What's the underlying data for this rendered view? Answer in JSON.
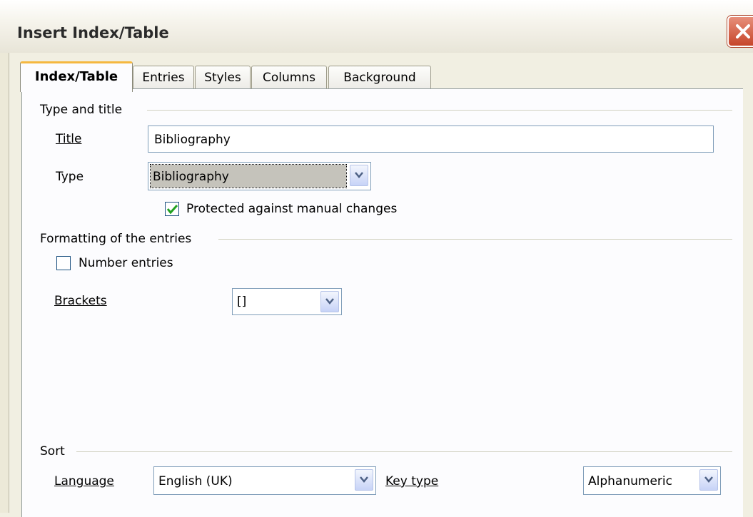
{
  "window": {
    "title": "Insert Index/Table"
  },
  "tabs": [
    {
      "label": "Index/Table",
      "active": true
    },
    {
      "label": "Entries",
      "active": false
    },
    {
      "label": "Styles",
      "active": false
    },
    {
      "label": "Columns",
      "active": false
    },
    {
      "label": "Background",
      "active": false
    }
  ],
  "type_and_title": {
    "section": "Type and title",
    "title_label": "Title",
    "title_value": "Bibliography",
    "type_label": "Type",
    "type_value": "Bibliography",
    "protected_label": "Protected against manual changes",
    "protected_checked": true
  },
  "formatting": {
    "section": "Formatting of the entries",
    "number_entries_label": "Number entries",
    "number_entries_checked": false,
    "brackets_label": "Brackets",
    "brackets_value": "[]"
  },
  "sort": {
    "section": "Sort",
    "language_label": "Language",
    "language_value": "English (UK)",
    "key_type_label": "Key type",
    "key_type_value": "Alphanumeric"
  },
  "icons": {
    "close": "close-icon",
    "dropdown": "chevron-down-icon",
    "check": "checkmark-icon"
  },
  "colors": {
    "active_tab_accent": "#f5b840",
    "close_button": "#c6452a",
    "checkmark": "#21a121"
  }
}
